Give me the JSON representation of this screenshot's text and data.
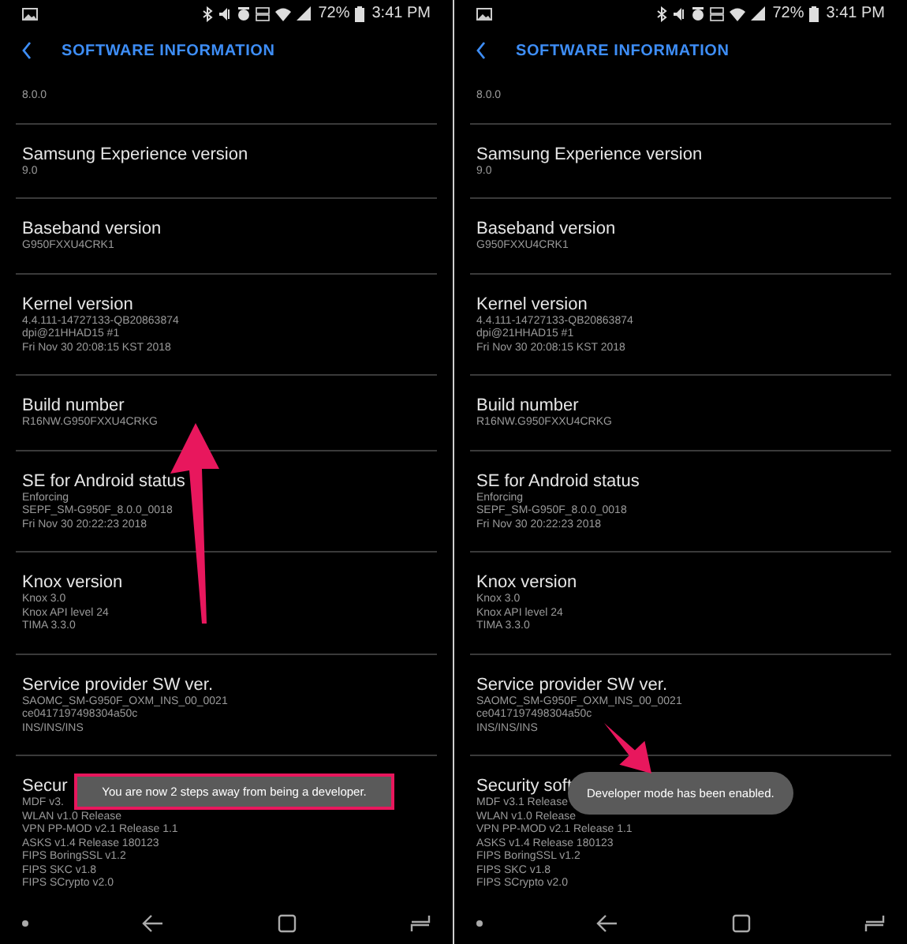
{
  "panels": [
    {
      "status_bar": {
        "battery": "72%",
        "time": "3:41 PM"
      },
      "title": "SOFTWARE INFORMATION",
      "sections": [
        {
          "values": [
            "8.0.0"
          ]
        },
        {
          "label": "Samsung Experience version",
          "values": [
            "9.0"
          ]
        },
        {
          "label": "Baseband version",
          "values": [
            "G950FXXU4CRK1"
          ]
        },
        {
          "label": "Kernel version",
          "values": [
            "4.4.111-14727133-QB20863874",
            "dpi@21HHAD15 #1",
            "Fri Nov 30 20:08:15 KST 2018"
          ]
        },
        {
          "label": "Build number",
          "values": [
            "R16NW.G950FXXU4CRKG"
          ]
        },
        {
          "label": "SE for Android status",
          "values": [
            "Enforcing",
            "SEPF_SM-G950F_8.0.0_0018",
            "Fri Nov 30 20:22:23 2018"
          ]
        },
        {
          "label": "Knox version",
          "values": [
            "Knox 3.0",
            "Knox API level 24",
            "TIMA 3.3.0"
          ]
        },
        {
          "label": "Service provider SW ver.",
          "values": [
            "SAOMC_SM-G950F_OXM_INS_00_0021",
            "ce0417197498304a50c",
            "INS/INS/INS"
          ]
        },
        {
          "label": "Secur",
          "values": [
            "MDF v3.",
            "WLAN v1.0 Release",
            "VPN PP-MOD v2.1 Release 1.1",
            "ASKS v1.4 Release 180123",
            "FIPS BoringSSL v1.2",
            "FIPS SKC v1.8",
            "FIPS SCrypto v2.0"
          ]
        }
      ],
      "toast": {
        "text": "You are now 2 steps away from being a developer.",
        "highlighted": true
      },
      "arrow": {
        "kind": "up"
      }
    },
    {
      "status_bar": {
        "battery": "72%",
        "time": "3:41 PM"
      },
      "title": "SOFTWARE INFORMATION",
      "sections": [
        {
          "values": [
            "8.0.0"
          ]
        },
        {
          "label": "Samsung Experience version",
          "values": [
            "9.0"
          ]
        },
        {
          "label": "Baseband version",
          "values": [
            "G950FXXU4CRK1"
          ]
        },
        {
          "label": "Kernel version",
          "values": [
            "4.4.111-14727133-QB20863874",
            "dpi@21HHAD15 #1",
            "Fri Nov 30 20:08:15 KST 2018"
          ]
        },
        {
          "label": "Build number",
          "values": [
            "R16NW.G950FXXU4CRKG"
          ]
        },
        {
          "label": "SE for Android status",
          "values": [
            "Enforcing",
            "SEPF_SM-G950F_8.0.0_0018",
            "Fri Nov 30 20:22:23 2018"
          ]
        },
        {
          "label": "Knox version",
          "values": [
            "Knox 3.0",
            "Knox API level 24",
            "TIMA 3.3.0"
          ]
        },
        {
          "label": "Service provider SW ver.",
          "values": [
            "SAOMC_SM-G950F_OXM_INS_00_0021",
            "ce0417197498304a50c",
            "INS/INS/INS"
          ]
        },
        {
          "label": "Security soft",
          "values": [
            "MDF v3.1 Release",
            "WLAN v1.0 Release",
            "VPN PP-MOD v2.1 Release 1.1",
            "ASKS v1.4 Release 180123",
            "FIPS BoringSSL v1.2",
            "FIPS SKC v1.8",
            "FIPS SCrypto v2.0"
          ]
        }
      ],
      "toast": {
        "text": "Developer mode has been enabled.",
        "highlighted": false
      },
      "arrow": {
        "kind": "down"
      }
    }
  ]
}
